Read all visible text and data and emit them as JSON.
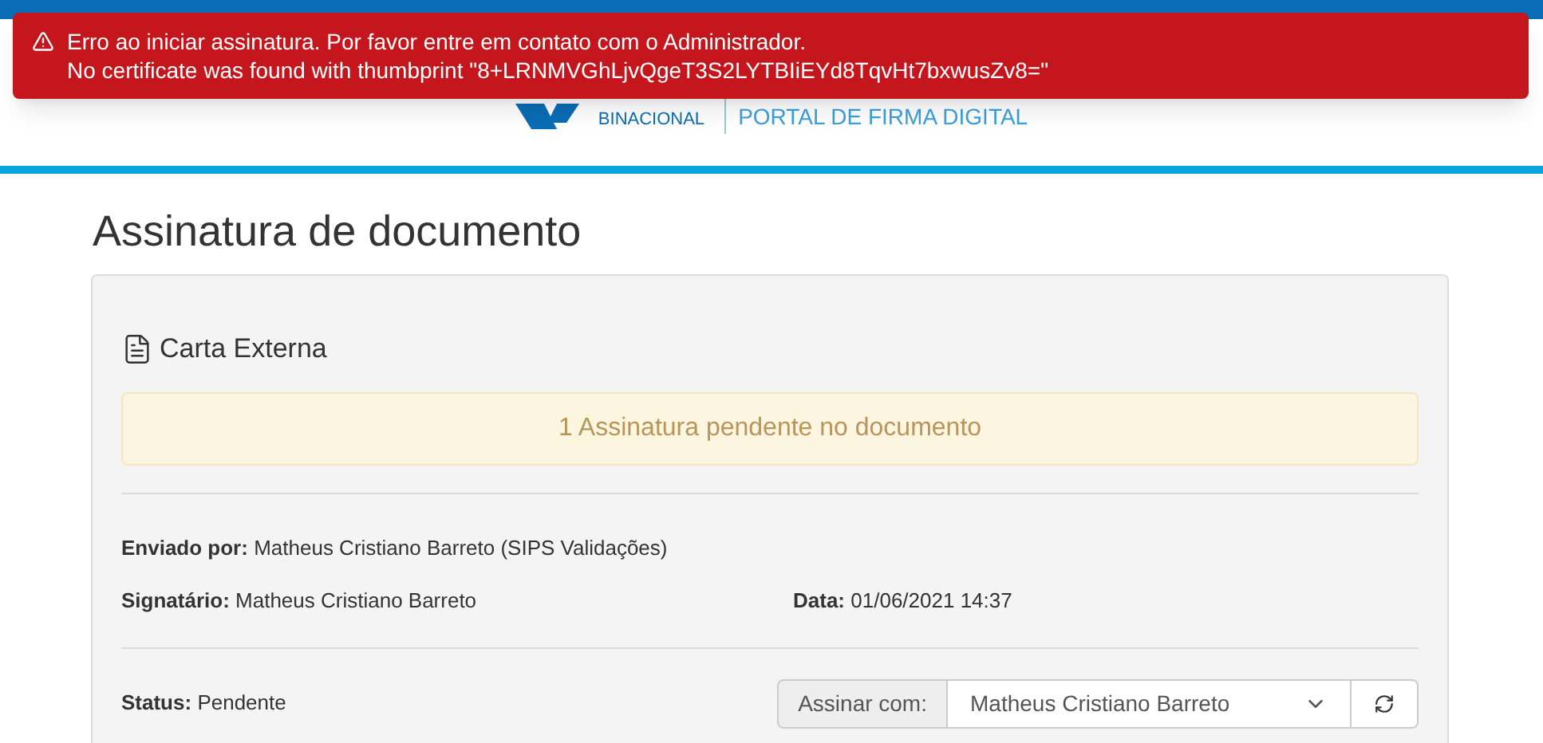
{
  "toast": {
    "kind": "error",
    "title": "Erro ao iniciar assinatura. Por favor entre em contato com o Administrador.",
    "message": "No certificate was found with thumbprint \"8+LRNMVGhLjvQgeT3S2LYTBIiEYd8TqvHt7bxwusZv8=\""
  },
  "header": {
    "logo_sub": "BINACIONAL",
    "portal": "PORTAL DE FIRMA DIGITAL"
  },
  "page_title": "Assinatura de documento",
  "document": {
    "name": "Carta Externa",
    "alert": "1 Assinatura pendente no documento",
    "fields": [
      {
        "label": "Enviado por:",
        "value": "Matheus Cristiano Barreto (SIPS Validações)"
      },
      {
        "label": "Signatário:",
        "value": "Matheus Cristiano Barreto"
      },
      {
        "label": "Data:",
        "value": "01/06/2021 14:37"
      }
    ],
    "status": {
      "label": "Status:",
      "value": "Pendente"
    },
    "sign_with": {
      "label": "Assinar com:",
      "value": "Matheus Cristiano Barreto"
    }
  }
}
